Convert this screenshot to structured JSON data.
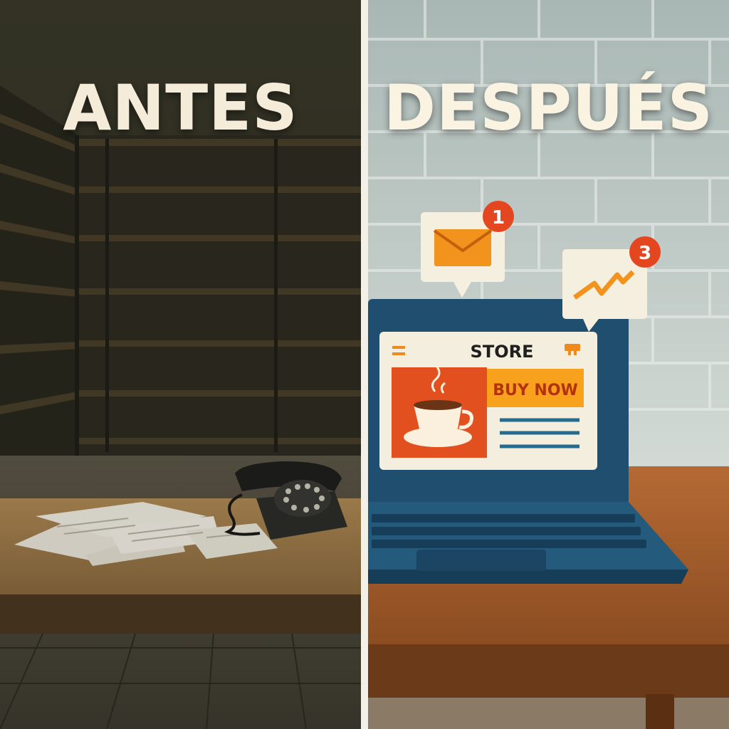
{
  "before": {
    "heading": "ANTES"
  },
  "after": {
    "heading": "DESPUÉS"
  },
  "store_screen": {
    "title": "STORE",
    "cta_label": "BUY NOW"
  },
  "notifications": [
    {
      "icon": "envelope-icon",
      "count": "1"
    },
    {
      "icon": "trend-up-icon",
      "count": "3"
    }
  ],
  "colors": {
    "accent_orange": "#f08a1c",
    "badge_red": "#e4461f",
    "laptop_blue": "#1f4e6e"
  }
}
